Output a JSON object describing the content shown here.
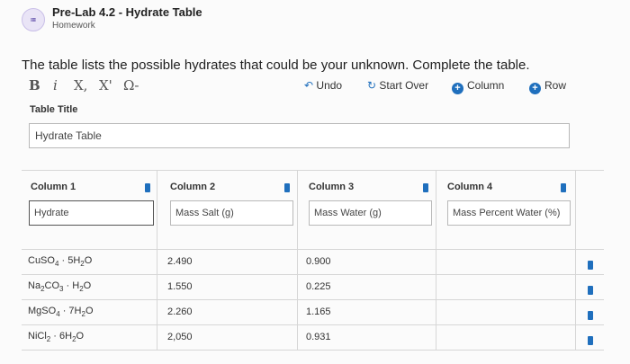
{
  "header": {
    "title": "Pre-Lab 4.2 - Hydrate Table",
    "subtitle": "Homework",
    "icon": "list-icon"
  },
  "instruction": "The table lists the possible hydrates that could be your unknown. Complete the table.",
  "toolbar": {
    "bold": "B",
    "italic": "i",
    "subscript": "X,",
    "superscript": "X'",
    "special_chars": "Ω-",
    "undo": "Undo",
    "start_over": "Start Over",
    "add_column": "Column",
    "add_row": "Row",
    "accent_color": "#1f6fbd"
  },
  "table_title": {
    "label": "Table Title",
    "value": "Hydrate Table"
  },
  "columns": [
    {
      "label": "Column 1",
      "value": "Hydrate"
    },
    {
      "label": "Column 2",
      "value": "Mass Salt (g)"
    },
    {
      "label": "Column 3",
      "value": "Mass Water (g)"
    },
    {
      "label": "Column 4",
      "value": "Mass Percent Water (%)"
    }
  ],
  "rows": [
    {
      "hydrate": [
        "CuSO",
        "4",
        " · 5H",
        "2",
        "O"
      ],
      "mass_salt": "2.490",
      "mass_water": "0.900"
    },
    {
      "hydrate": [
        "Na",
        "2",
        "CO",
        "3",
        " · H",
        "2",
        "O"
      ],
      "mass_salt": "1.550",
      "mass_water": "0.225"
    },
    {
      "hydrate": [
        "MgSO",
        "4",
        " · 7H",
        "2",
        "O"
      ],
      "mass_salt": "2.260",
      "mass_water": "1.165"
    },
    {
      "hydrate": [
        "NiCl",
        "2",
        " · 6H",
        "2",
        "O"
      ],
      "mass_salt": "2,050",
      "mass_water": "0.931"
    }
  ]
}
